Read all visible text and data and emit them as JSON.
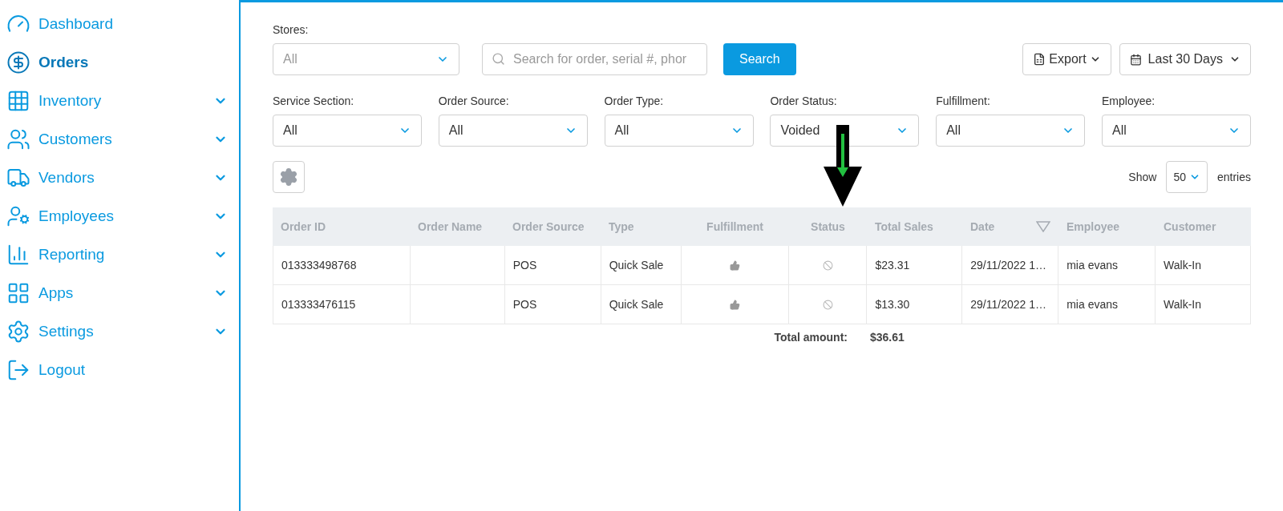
{
  "sidebar": {
    "items": [
      {
        "label": "Dashboard",
        "selected": false,
        "expandable": false
      },
      {
        "label": "Orders",
        "selected": true,
        "expandable": false
      },
      {
        "label": "Inventory",
        "selected": false,
        "expandable": true
      },
      {
        "label": "Customers",
        "selected": false,
        "expandable": true
      },
      {
        "label": "Vendors",
        "selected": false,
        "expandable": true
      },
      {
        "label": "Employees",
        "selected": false,
        "expandable": true
      },
      {
        "label": "Reporting",
        "selected": false,
        "expandable": true
      },
      {
        "label": "Apps",
        "selected": false,
        "expandable": true
      },
      {
        "label": "Settings",
        "selected": false,
        "expandable": true
      },
      {
        "label": "Logout",
        "selected": false,
        "expandable": false
      }
    ]
  },
  "toolbar": {
    "stores": {
      "label": "Stores:",
      "placeholder": "All"
    },
    "search": {
      "placeholder": "Search for order, serial #, phor"
    },
    "search_button": "Search",
    "export_button": "Export",
    "date_range_button": "Last 30 Days"
  },
  "filters": [
    {
      "label": "Service Section:",
      "value": "All"
    },
    {
      "label": "Order Source:",
      "value": "All"
    },
    {
      "label": "Order Type:",
      "value": "All"
    },
    {
      "label": "Order Status:",
      "value": "Voided"
    },
    {
      "label": "Fulfillment:",
      "value": "All"
    },
    {
      "label": "Employee:",
      "value": "All"
    }
  ],
  "entries": {
    "show": "Show",
    "value": "50",
    "suffix": "entries"
  },
  "table": {
    "columns": [
      {
        "label": "Order ID",
        "sorted": false
      },
      {
        "label": "Order Name",
        "sorted": false
      },
      {
        "label": "Order Source",
        "sorted": false
      },
      {
        "label": "Type",
        "sorted": false
      },
      {
        "label": "Fulfillment",
        "sorted": false
      },
      {
        "label": "Status",
        "sorted": false
      },
      {
        "label": "Total Sales",
        "sorted": false
      },
      {
        "label": "Date",
        "sorted": true
      },
      {
        "label": "Employee",
        "sorted": false
      },
      {
        "label": "Customer",
        "sorted": false
      }
    ],
    "rows": [
      {
        "order_id": "013333498768",
        "order_source": "POS",
        "type": "Quick Sale",
        "total_sales": "$23.31",
        "date": "29/11/2022 1…",
        "employee": "mia evans",
        "customer": "Walk-In"
      },
      {
        "order_id": "013333476115",
        "order_source": "POS",
        "type": "Quick Sale",
        "total_sales": "$13.30",
        "date": "29/11/2022 1…",
        "employee": "mia evans",
        "customer": "Walk-In"
      }
    ],
    "total": {
      "label": "Total amount:",
      "value": "$36.61"
    }
  }
}
